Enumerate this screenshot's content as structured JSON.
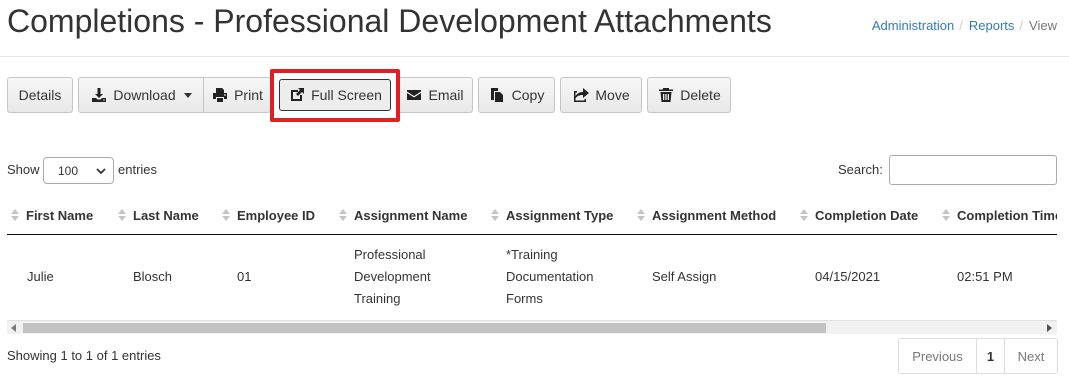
{
  "header": {
    "title": "Completions - Professional Development Attachments",
    "breadcrumb": [
      {
        "label": "Administration",
        "active": false
      },
      {
        "label": "Reports",
        "active": false
      },
      {
        "label": "View",
        "active": true
      }
    ],
    "separator": "/"
  },
  "toolbar": {
    "details": "Details",
    "download": "Download",
    "print": "Print",
    "full_screen": "Full Screen",
    "email": "Email",
    "copy": "Copy",
    "move": "Move",
    "delete": "Delete"
  },
  "table_controls": {
    "show_label": "Show",
    "entries_label": "entries",
    "page_length": "100",
    "search_label": "Search:",
    "search_value": ""
  },
  "table": {
    "columns": [
      "First Name",
      "Last Name",
      "Employee ID",
      "Assignment Name",
      "Assignment Type",
      "Assignment Method",
      "Completion Date",
      "Completion Time"
    ],
    "rows": [
      {
        "first_name": "Julie",
        "last_name": "Blosch",
        "employee_id": "01",
        "assignment_name": [
          "Professional",
          "Development",
          "Training"
        ],
        "assignment_type": [
          "*Training",
          "Documentation",
          "Forms"
        ],
        "assignment_method": "Self Assign",
        "completion_date": "04/15/2021",
        "completion_time": "02:51 PM"
      }
    ]
  },
  "footer": {
    "info": "Showing 1 to 1 of 1 entries",
    "pagination": {
      "previous": "Previous",
      "current": "1",
      "next": "Next"
    }
  },
  "colors": {
    "link": "#337ab7",
    "highlight": "#e02020",
    "header_rule": "#111111"
  },
  "icons": [
    "download-icon",
    "caret-down-icon",
    "print-icon",
    "external-link-icon",
    "envelope-icon",
    "copy-icon",
    "share-icon",
    "trash-icon",
    "sort-icon",
    "chevron-down-icon"
  ]
}
